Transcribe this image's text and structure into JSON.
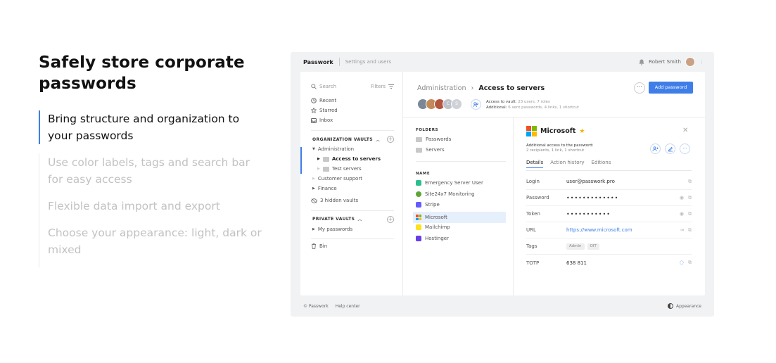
{
  "marketing": {
    "title": "Safely store corporate passwords",
    "features": [
      "Bring structure and organization to your passwords",
      "Use color labels, tags and search bar for easy access",
      "Flexible data import and export",
      "Choose your appearance: light, dark or mixed"
    ]
  },
  "topbar": {
    "brand": "Passwork",
    "settings_link": "Settings and users",
    "user_name": "Robert Smith"
  },
  "sidebar": {
    "search_placeholder": "Search",
    "filters": "Filters",
    "nav": [
      "Recent",
      "Starred",
      "Inbox"
    ],
    "org_header": "ORGANIZATION VAULTS",
    "org_items": {
      "administration": "Administration",
      "access_to_servers": "Access to servers",
      "test_servers": "Test servers",
      "customer_support": "Customer support",
      "finance": "Finance",
      "hidden_vaults": "3 hidden vaults"
    },
    "private_header": "PRIVATE VAULTS",
    "my_passwords": "My passwords",
    "bin": "Bin"
  },
  "header": {
    "breadcrumb_parent": "Administration",
    "breadcrumb_current": "Access to servers",
    "add_button": "Add password",
    "avatar_extra_1": "C",
    "avatar_extra_2": "S",
    "access_label": "Access to vault:",
    "access_value": "23 users, 7 roles",
    "additional_label": "Additional:",
    "additional_value": "6 sent passwords, 4 links, 1 shortcut"
  },
  "folders": {
    "folders_header": "FOLDERS",
    "folder_items": [
      "Passwords",
      "Servers"
    ],
    "name_header": "NAME",
    "entries": [
      {
        "name": "Emergency Server User",
        "color": "#2bbf8f"
      },
      {
        "name": "Site24x7 Monitoring",
        "color": "#5aa832"
      },
      {
        "name": "Stripe",
        "color": "#635bff"
      },
      {
        "name": "Microsoft",
        "color": "#f25022"
      },
      {
        "name": "Mailchimp",
        "color": "#ffe01b"
      },
      {
        "name": "Hostinger",
        "color": "#673de6"
      }
    ]
  },
  "detail": {
    "title": "Microsoft",
    "additional_label": "Additional access to the password:",
    "additional_value": "2 recipients, 1 link, 1 shortcut",
    "tabs": [
      "Details",
      "Action history",
      "Editions"
    ],
    "fields": {
      "login_label": "Login",
      "login_value": "user@passwork.pro",
      "password_label": "Password",
      "password_value": "•••••••••••••",
      "token_label": "Token",
      "token_value": "•••••••••••",
      "url_label": "URL",
      "url_value": "https://www.microsoft.com",
      "tags_label": "Tags",
      "tag_1": "Admin",
      "tag_2": "OIT",
      "totp_label": "TOTP",
      "totp_value": "638 811"
    }
  },
  "footer": {
    "copyright": "© Passwork",
    "help": "Help center",
    "appearance": "Appearance"
  },
  "colors": {
    "accent": "#3f7ee8",
    "selected_row": "#e6effc",
    "star": "#f0b400"
  }
}
